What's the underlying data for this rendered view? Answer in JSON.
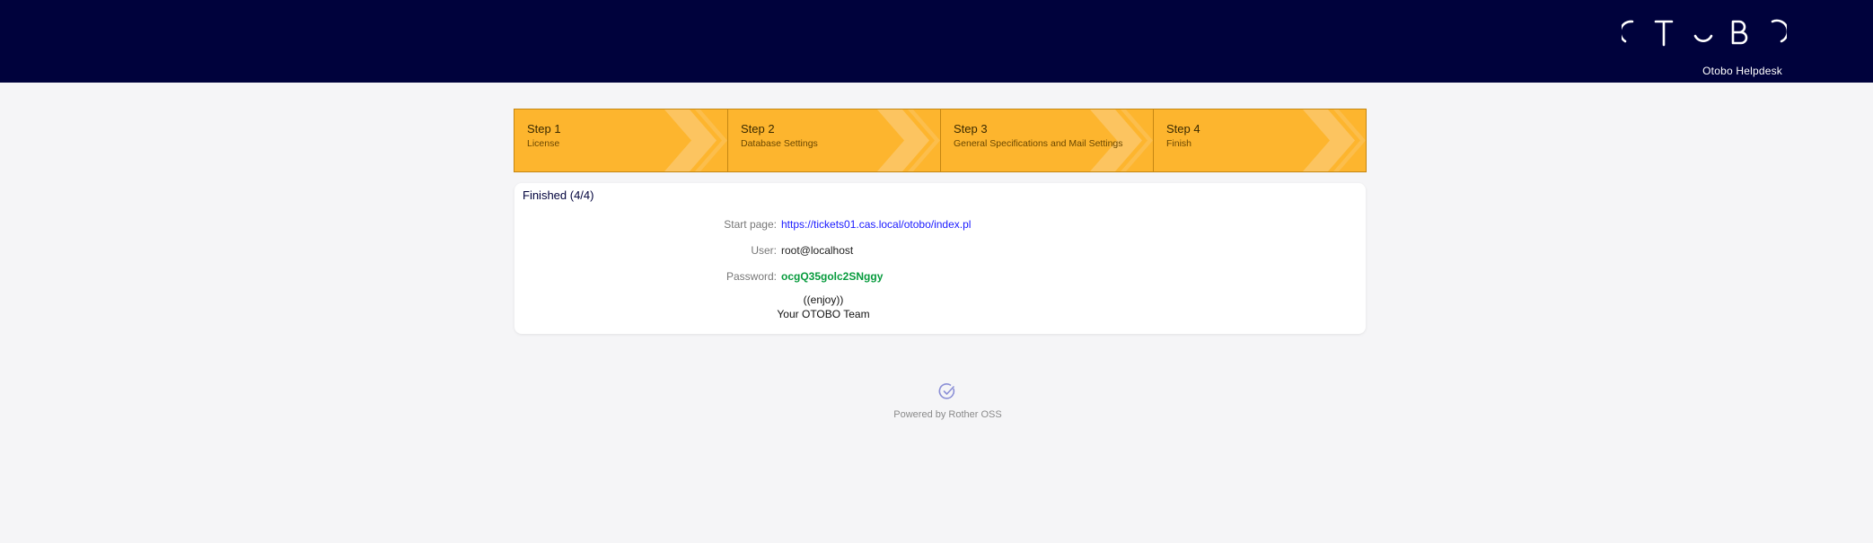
{
  "header": {
    "brand_name": "Otobo Helpdesk",
    "logo_letters": "OTOBO"
  },
  "steps": [
    {
      "title": "Step 1",
      "subtitle": "License"
    },
    {
      "title": "Step 2",
      "subtitle": "Database Settings"
    },
    {
      "title": "Step 3",
      "subtitle": "General Specifications and Mail Settings"
    },
    {
      "title": "Step 4",
      "subtitle": "Finish"
    }
  ],
  "result": {
    "title": "Finished (4/4)",
    "start_page_label": "Start page:",
    "start_page_value": "https://tickets01.cas.local/otobo/index.pl",
    "user_label": "User:",
    "user_value": "root@localhost",
    "password_label": "Password:",
    "password_value": "ocgQ35golc2SNggy",
    "enjoy_line1": "((enjoy))",
    "enjoy_line2": "Your OTOBO Team"
  },
  "footer": {
    "powered_by": "Powered by Rother OSS",
    "icon": "check-circle-icon"
  },
  "colors": {
    "header_bg": "#00023c",
    "steps_bg": "#fdb52e",
    "link": "#1a1aff",
    "password": "#079b3d",
    "page_bg": "#f5f5f7"
  }
}
